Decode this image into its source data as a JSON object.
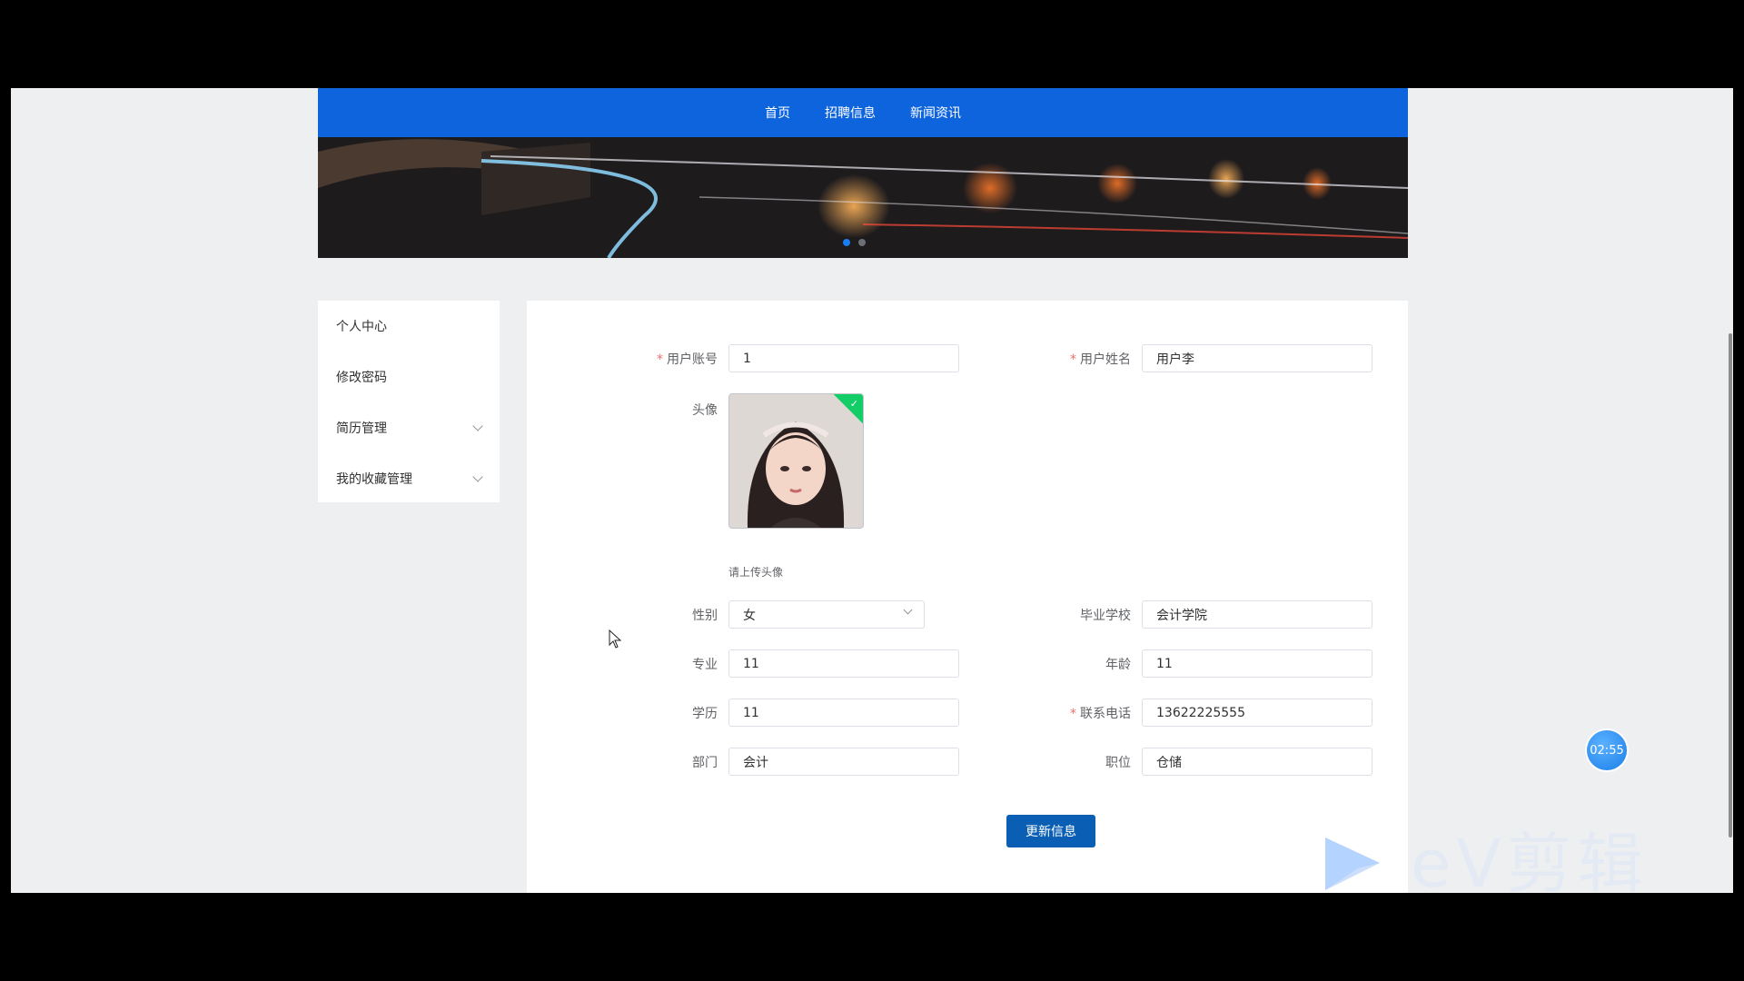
{
  "nav": {
    "items": [
      "首页",
      "招聘信息",
      "新闻资讯"
    ]
  },
  "sidebar": {
    "items": [
      {
        "label": "个人中心",
        "expandable": false
      },
      {
        "label": "修改密码",
        "expandable": false
      },
      {
        "label": "简历管理",
        "expandable": true
      },
      {
        "label": "我的收藏管理",
        "expandable": true
      }
    ]
  },
  "form": {
    "account": {
      "label": "用户账号",
      "value": "1",
      "required": true
    },
    "name": {
      "label": "用户姓名",
      "value": "用户李",
      "required": true
    },
    "avatar": {
      "label": "头像",
      "hint": "请上传头像"
    },
    "gender": {
      "label": "性别",
      "value": "女"
    },
    "school": {
      "label": "毕业学校",
      "value": "会计学院"
    },
    "major": {
      "label": "专业",
      "value": "11"
    },
    "age": {
      "label": "年龄",
      "value": "11"
    },
    "education": {
      "label": "学历",
      "value": "11"
    },
    "phone": {
      "label": "联系电话",
      "value": "13622225555",
      "required": true
    },
    "department": {
      "label": "部门",
      "value": "会计"
    },
    "position": {
      "label": "职位",
      "value": "仓储"
    },
    "submit_label": "更新信息"
  },
  "timer": "02:55",
  "watermark": "eV剪辑",
  "colors": {
    "nav": "#0e64dd",
    "primary": "#0a5fb4",
    "required": "#f56c6c"
  },
  "icons": {
    "chevron": "chevron-down-icon",
    "check": "check-icon",
    "cursor": "mouse-cursor-icon"
  }
}
